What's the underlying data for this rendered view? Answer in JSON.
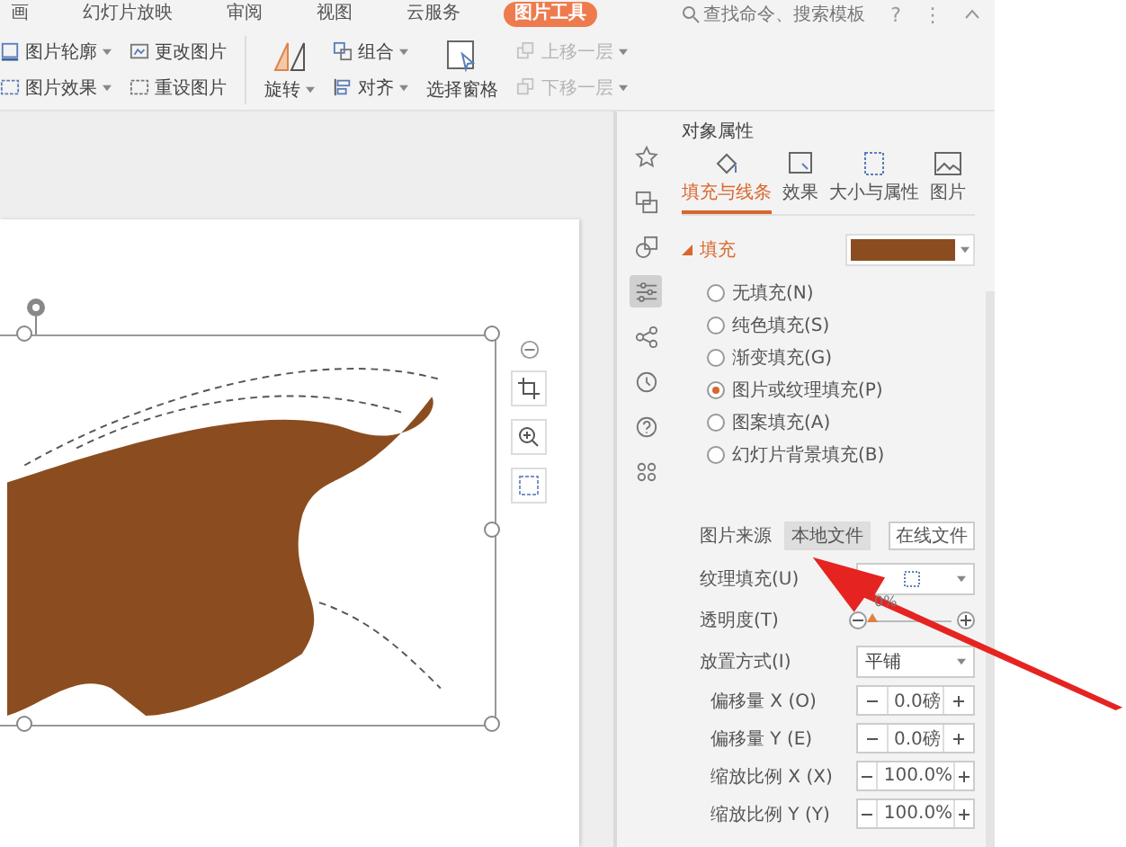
{
  "menu_tabs": [
    {
      "label": "画",
      "selected": false
    },
    {
      "label": "幻灯片放映",
      "selected": false
    },
    {
      "label": "审阅",
      "selected": false
    },
    {
      "label": "视图",
      "selected": false
    },
    {
      "label": "云服务",
      "selected": false
    },
    {
      "label": "图片工具",
      "selected": true
    }
  ],
  "search": {
    "placeholder": "查找命令、搜索模板"
  },
  "title_controls": [
    "?",
    "⋮"
  ],
  "ribbon": {
    "column_1": [
      {
        "kind": "outline",
        "label": "图片轮廓",
        "dropdown": true,
        "disabled": false
      },
      {
        "kind": "effect",
        "label": "图片效果",
        "dropdown": true,
        "disabled": false
      }
    ],
    "column_2": [
      {
        "kind": "change",
        "label": "更改图片",
        "dropdown": false,
        "disabled": false
      },
      {
        "kind": "reset",
        "label": "重设图片",
        "dropdown": false,
        "disabled": false
      }
    ],
    "rotate": {
      "label": "旋转",
      "dropdown": true
    },
    "column_3": [
      {
        "kind": "group",
        "label": "组合",
        "dropdown": true,
        "disabled": false
      },
      {
        "kind": "align",
        "label": "对齐",
        "dropdown": true,
        "disabled": false
      }
    ],
    "selection_pane": {
      "label": "选择窗格"
    },
    "column_4": [
      {
        "kind": "up",
        "label": "上移一层",
        "dropdown": true,
        "disabled": true
      },
      {
        "kind": "down",
        "label": "下移一层",
        "dropdown": true,
        "disabled": true
      }
    ]
  },
  "side_tools": [
    {
      "kind": "star",
      "selected": false
    },
    {
      "kind": "shapes",
      "selected": false
    },
    {
      "kind": "circles",
      "selected": false
    },
    {
      "kind": "sliders",
      "selected": true
    },
    {
      "kind": "share",
      "selected": false
    },
    {
      "kind": "history",
      "selected": false
    },
    {
      "kind": "help",
      "selected": false
    },
    {
      "kind": "grid",
      "selected": false
    }
  ],
  "panel": {
    "title": "对象属性",
    "tabs": [
      {
        "kind": "fill",
        "label": "填充与线条",
        "selected": true
      },
      {
        "kind": "effect",
        "label": "效果",
        "selected": false
      },
      {
        "kind": "size",
        "label": "大小与属性",
        "selected": false
      },
      {
        "kind": "picture",
        "label": "图片",
        "selected": false
      }
    ],
    "fill_section": {
      "label": "填充",
      "expanded": true
    },
    "fill_options": [
      {
        "label": "无填充(N)",
        "selected": false
      },
      {
        "label": "纯色填充(S)",
        "selected": false
      },
      {
        "label": "渐变填充(G)",
        "selected": false
      },
      {
        "label": "图片或纹理填充(P)",
        "selected": true
      },
      {
        "label": "图案填充(A)",
        "selected": false
      },
      {
        "label": "幻灯片背景填充(B)",
        "selected": false
      }
    ],
    "source": {
      "label": "图片来源",
      "buttons": [
        {
          "label": "本地文件",
          "selected": true
        },
        {
          "label": "在线文件",
          "selected": false
        }
      ]
    },
    "texture": {
      "label": "纹理填充(U)"
    },
    "transparency": {
      "label": "透明度(T)",
      "reading": "0%",
      "level": 0
    },
    "placement": {
      "label": "放置方式(I)",
      "value": "平铺"
    },
    "steppers": [
      {
        "label": "偏移量 X (O)",
        "value": "0.0磅"
      },
      {
        "label": "偏移量 Y (E)",
        "value": "0.0磅"
      },
      {
        "label": "缩放比例 X (X)",
        "value": "100.0%"
      },
      {
        "label": "缩放比例 Y (Y)",
        "value": "100.0%"
      }
    ]
  }
}
